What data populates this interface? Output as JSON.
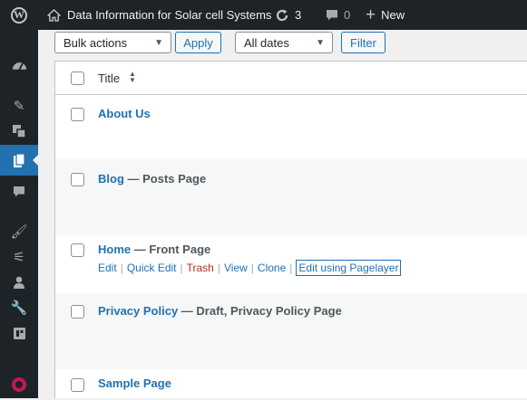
{
  "admin_bar": {
    "wp_logo": "W",
    "site_name": "Data Information for Solar cell Systems",
    "updates_count": "3",
    "comments_count": "0",
    "new_label": "New"
  },
  "side_menu": [
    {
      "icon": "dashboard-icon",
      "current": false
    },
    {
      "icon": "pin-icon",
      "current": false
    },
    {
      "icon": "media-icon",
      "current": false
    },
    {
      "icon": "pages-icon",
      "current": true
    },
    {
      "icon": "comments-icon",
      "current": false
    },
    {
      "icon": "appearance-icon",
      "current": false
    },
    {
      "icon": "plugins-icon",
      "current": false
    },
    {
      "icon": "users-icon",
      "current": false
    },
    {
      "icon": "tools-icon",
      "current": false
    },
    {
      "icon": "settings-icon",
      "current": false
    },
    {
      "icon": "pagelayer-icon",
      "current": false
    }
  ],
  "toolbar": {
    "bulk_actions": "Bulk actions",
    "apply": "Apply",
    "dates": "All dates",
    "filter": "Filter"
  },
  "table": {
    "title_header": "Title",
    "rows": [
      {
        "title": "About Us",
        "state": ""
      },
      {
        "title": "Blog",
        "state": " — Posts Page"
      },
      {
        "title": "Home",
        "state": " — Front Page"
      },
      {
        "title": "Privacy Policy",
        "state": " — Draft, Privacy Policy Page"
      },
      {
        "title": "Sample Page",
        "state": ""
      }
    ],
    "row_actions": {
      "edit": "Edit",
      "quick_edit": "Quick Edit",
      "trash": "Trash",
      "view": "View",
      "clone": "Clone",
      "edit_pagelayer": "Edit using Pagelayer"
    }
  },
  "colors": {
    "admin_bar_bg": "#1d2327",
    "accent": "#2271b1",
    "trash": "#b32d2e"
  }
}
